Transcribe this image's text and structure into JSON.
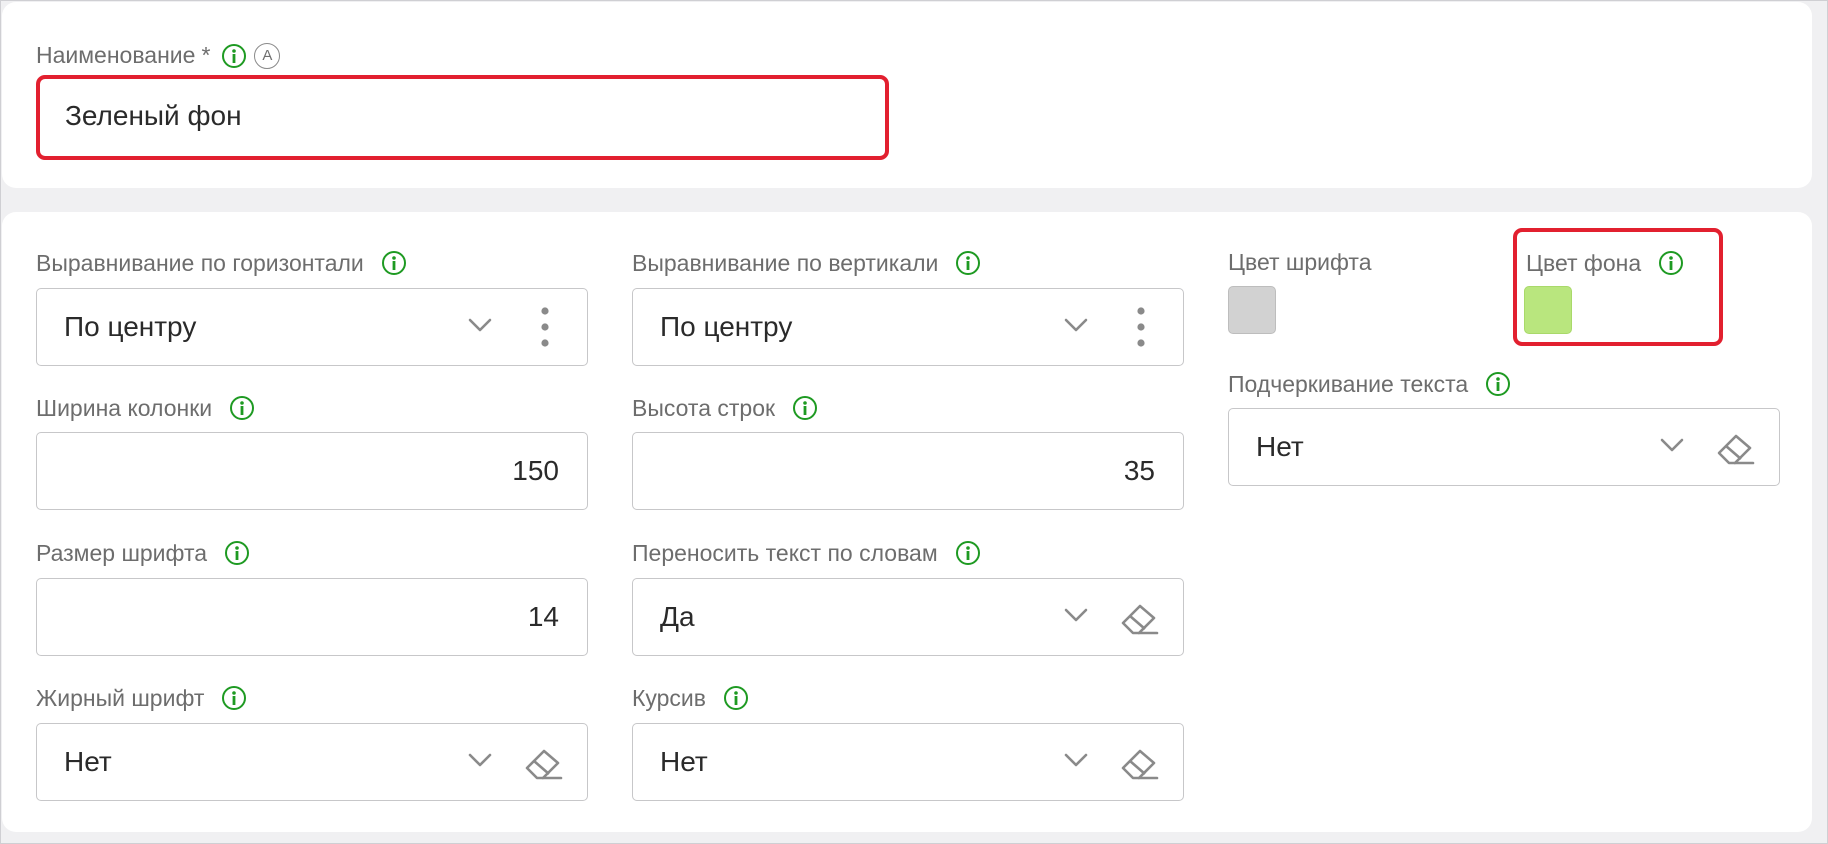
{
  "name_section": {
    "label": "Наименование",
    "required_mark": "*",
    "auto_badge": "A",
    "value": "Зеленый фон"
  },
  "fields": {
    "h_align": {
      "label": "Выравнивание по горизонтали",
      "value": "По центру"
    },
    "v_align": {
      "label": "Выравнивание по вертикали",
      "value": "По центру"
    },
    "col_width": {
      "label": "Ширина колонки",
      "value": "150"
    },
    "row_height": {
      "label": "Высота строк",
      "value": "35"
    },
    "font_size": {
      "label": "Размер шрифта",
      "value": "14"
    },
    "word_wrap": {
      "label": "Переносить текст по словам",
      "value": "Да"
    },
    "bold": {
      "label": "Жирный шрифт",
      "value": "Нет"
    },
    "italic": {
      "label": "Курсив",
      "value": "Нет"
    },
    "font_color": {
      "label": "Цвет шрифта",
      "color": "#d2d2d2"
    },
    "bg_color": {
      "label": "Цвет фона",
      "color": "#b9e67e"
    },
    "underline": {
      "label": "Подчеркивание текста",
      "value": "Нет"
    }
  },
  "icons": {
    "info": "info-icon",
    "chevron": "chevron-down-icon",
    "kebab": "more-vertical-icon",
    "eraser": "eraser-icon"
  },
  "colors": {
    "highlight": "#e2202f",
    "info_green": "#1e9a22"
  }
}
